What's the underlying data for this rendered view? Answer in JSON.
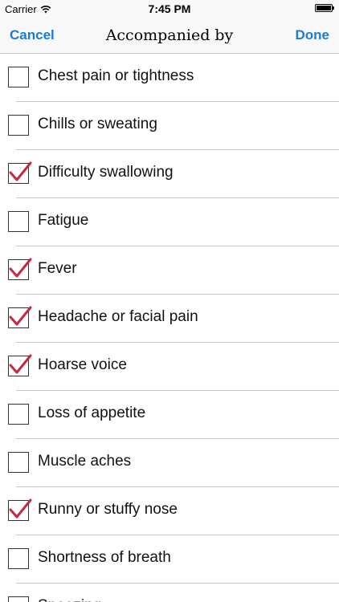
{
  "status_bar": {
    "carrier": "Carrier",
    "time": "7:45 PM",
    "wifi_icon": "wifi-icon",
    "battery_icon": "battery-icon"
  },
  "nav_bar": {
    "cancel_label": "Cancel",
    "title": "Accompanied by",
    "done_label": "Done"
  },
  "colors": {
    "accent": "#1a7bd8",
    "check": "#c8283d"
  },
  "symptoms": [
    {
      "label": "Chest pain or tightness",
      "checked": false
    },
    {
      "label": "Chills or sweating",
      "checked": false
    },
    {
      "label": "Difficulty swallowing",
      "checked": true
    },
    {
      "label": "Fatigue",
      "checked": false
    },
    {
      "label": "Fever",
      "checked": true
    },
    {
      "label": "Headache or facial pain",
      "checked": true
    },
    {
      "label": "Hoarse voice",
      "checked": true
    },
    {
      "label": "Loss of appetite",
      "checked": false
    },
    {
      "label": "Muscle aches",
      "checked": false
    },
    {
      "label": "Runny or stuffy nose",
      "checked": true
    },
    {
      "label": "Shortness of breath",
      "checked": false
    },
    {
      "label": "Sneezing",
      "checked": false
    }
  ]
}
